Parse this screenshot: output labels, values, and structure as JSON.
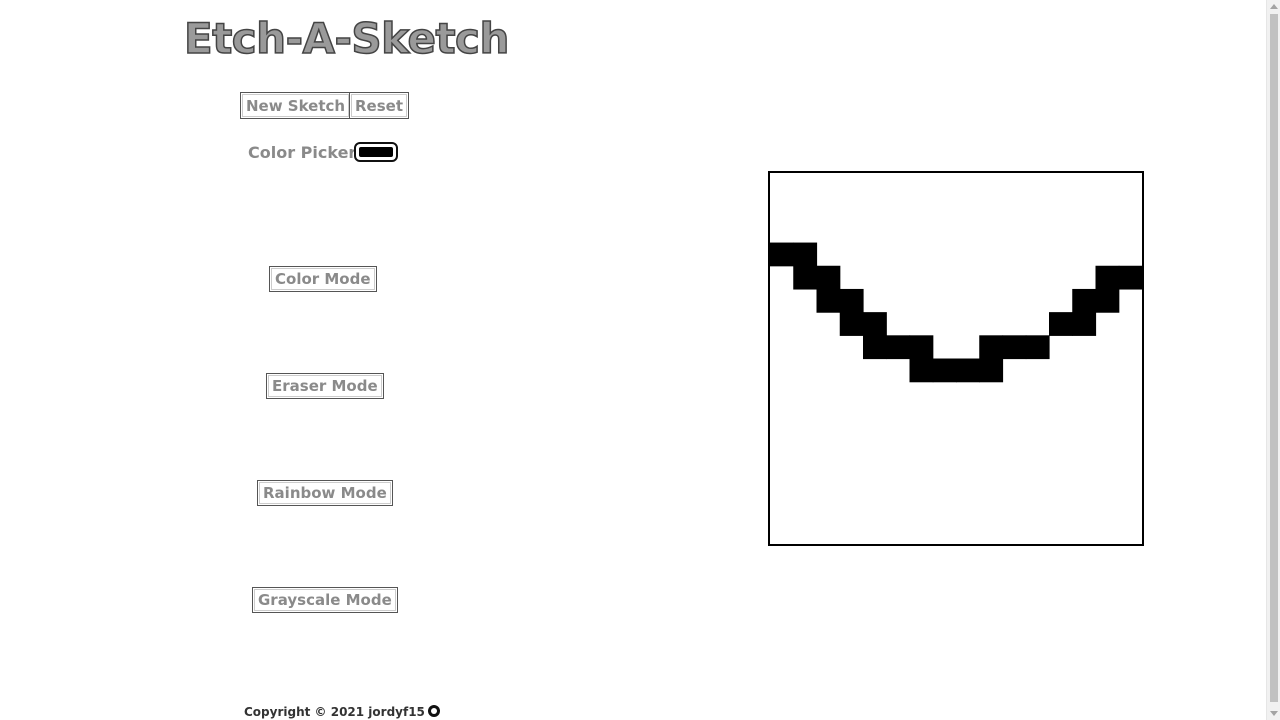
{
  "header": {
    "title": "Etch-A-Sketch"
  },
  "controls": {
    "new_sketch_label": "New Sketch",
    "reset_label": "Reset",
    "color_picker_label": "Color Picker:",
    "color_picker_value": "#000000"
  },
  "modes": {
    "color_mode_label": "Color Mode",
    "eraser_mode_label": "Eraser Mode",
    "rainbow_mode_label": "Rainbow Mode",
    "grayscale_mode_label": "Grayscale Mode"
  },
  "sketch": {
    "grid_size": 16,
    "ink_color": "#000000",
    "filled_cells": [
      [
        0,
        3
      ],
      [
        1,
        3
      ],
      [
        1,
        4
      ],
      [
        2,
        4
      ],
      [
        2,
        5
      ],
      [
        3,
        5
      ],
      [
        3,
        6
      ],
      [
        4,
        6
      ],
      [
        4,
        7
      ],
      [
        5,
        7
      ],
      [
        6,
        7
      ],
      [
        6,
        8
      ],
      [
        7,
        8
      ],
      [
        8,
        8
      ],
      [
        9,
        8
      ],
      [
        9,
        7
      ],
      [
        10,
        7
      ],
      [
        11,
        7
      ],
      [
        12,
        6
      ],
      [
        13,
        6
      ],
      [
        13,
        5
      ],
      [
        14,
        5
      ],
      [
        14,
        4
      ],
      [
        15,
        4
      ]
    ]
  },
  "footer": {
    "copyright": "Copyright © 2021 jordyf15",
    "github_icon": "github-icon"
  }
}
